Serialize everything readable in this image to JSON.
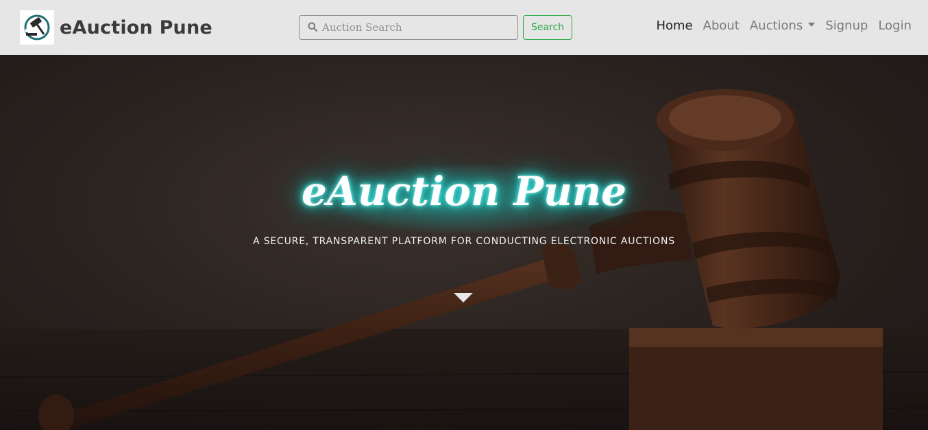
{
  "brand": {
    "name": "eAuction Pune",
    "logo_icon": "gavel-icon"
  },
  "search": {
    "placeholder": "Auction Search",
    "value": "",
    "button_label": "Search",
    "icon": "search-icon"
  },
  "nav": {
    "items": [
      {
        "label": "Home",
        "active": true
      },
      {
        "label": "About",
        "active": false
      },
      {
        "label": "Auctions",
        "active": false,
        "dropdown": true
      },
      {
        "label": "Signup",
        "active": false
      },
      {
        "label": "Login",
        "active": false
      }
    ]
  },
  "hero": {
    "title": "eAuction Pune",
    "subtitle": "A SECURE, TRANSPARENT PLATFORM FOR CONDUCTING ELECTRONIC AUCTIONS",
    "scroll_icon": "triangle-down-icon"
  },
  "colors": {
    "navbar_bg": "#e6e6e6",
    "search_button": "#28a745",
    "glow": "#2fd9d2",
    "nav_active": "#1f1f1f",
    "nav_inactive": "#7a7a7a"
  }
}
